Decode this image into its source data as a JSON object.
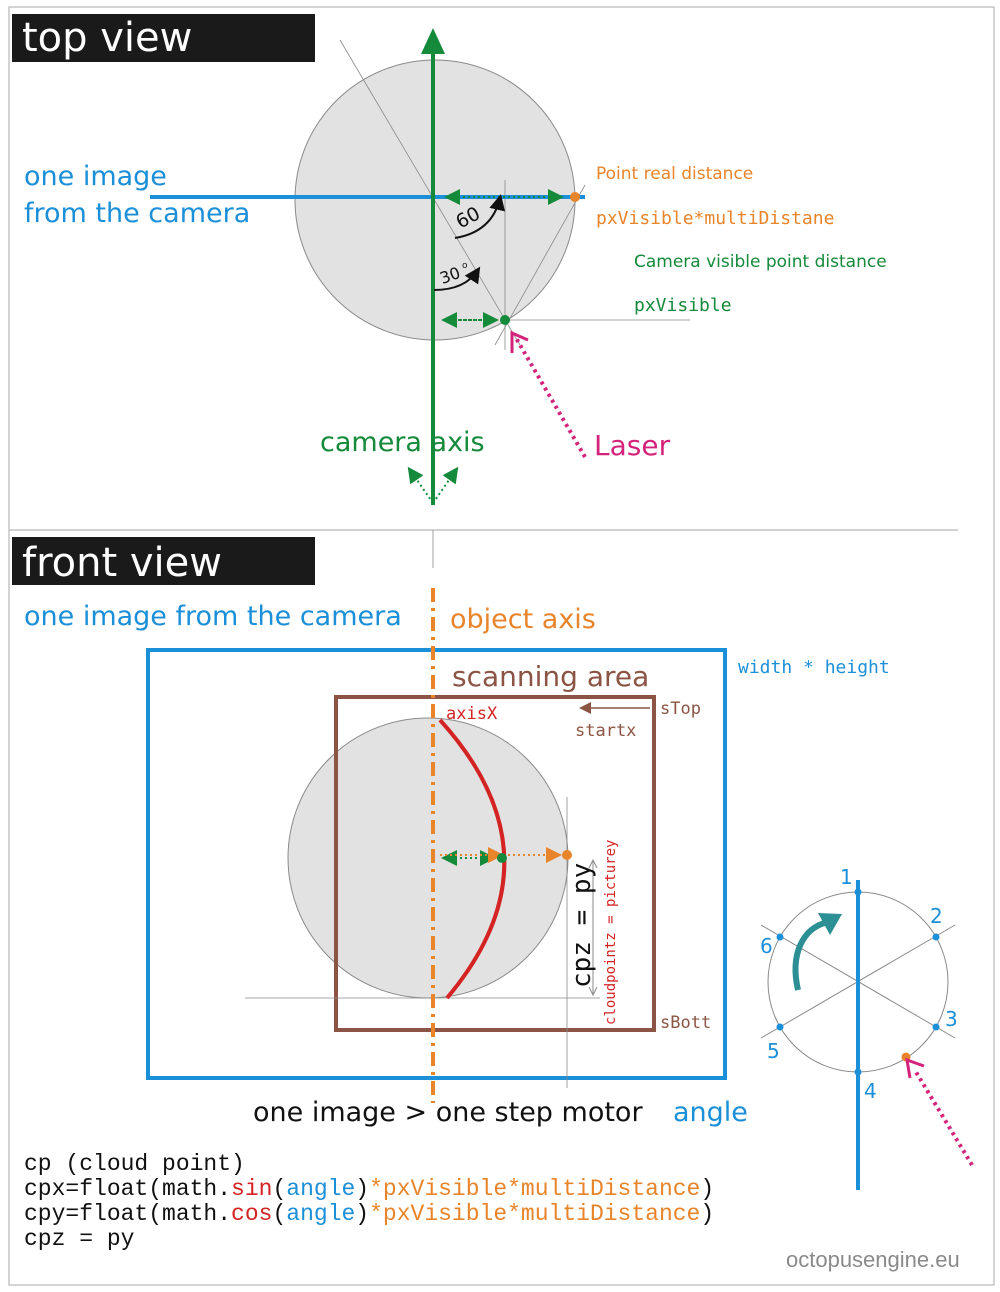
{
  "colors": {
    "blue": "#1b8fd8",
    "green": "#148a3a",
    "orange": "#e8842a",
    "magenta": "#d4237a",
    "brown": "#8b5444",
    "red": "#d42323",
    "circle_fill": "#e2e2e2",
    "heading_bg": "#1a1a1a"
  },
  "top_view": {
    "heading": "top view",
    "camera_image_label_line1": "one image",
    "camera_image_label_line2": "from the camera",
    "point_real_distance": "Point real distance",
    "px_visible_multi": "pxVisible*multiDistane",
    "camera_visible_point_distance": "Camera visible point distance",
    "px_visible": "pxVisible",
    "angle_60": "60",
    "angle_30": "30",
    "degree_mark": "o",
    "camera_axis": "camera axis",
    "laser": "Laser"
  },
  "front_view": {
    "heading": "front view",
    "camera_image_label": "one image from the camera",
    "object_axis": "object axis",
    "width_height": "width * height",
    "scanning_area": "scanning area",
    "axis_x": "axisX",
    "s_top": "sTop",
    "start_x": "startx",
    "s_bott": "sBott",
    "cpz_py": "cpz = py",
    "cloudpointz_picturey": "cloudpointz = picturey",
    "caption_part1": "one image > one step motor",
    "caption_part2": "angle",
    "steps": [
      "1",
      "2",
      "3",
      "4",
      "5",
      "6"
    ]
  },
  "code": {
    "line1": "cp (cloud point)",
    "line2": {
      "a": "cpx=float(math.",
      "fn": "sin",
      "b": "(",
      "arg": "angle",
      "c": ")",
      "expr": "*pxVisible*multiDistance",
      "d": ")"
    },
    "line3": {
      "a": "cpy=float(math.",
      "fn": "cos",
      "b": "(",
      "arg": "angle",
      "c": ")",
      "expr": "*pxVisible*multiDistance",
      "d": ")"
    },
    "line4": "cpz = py"
  },
  "footer": "octopusengine.eu"
}
